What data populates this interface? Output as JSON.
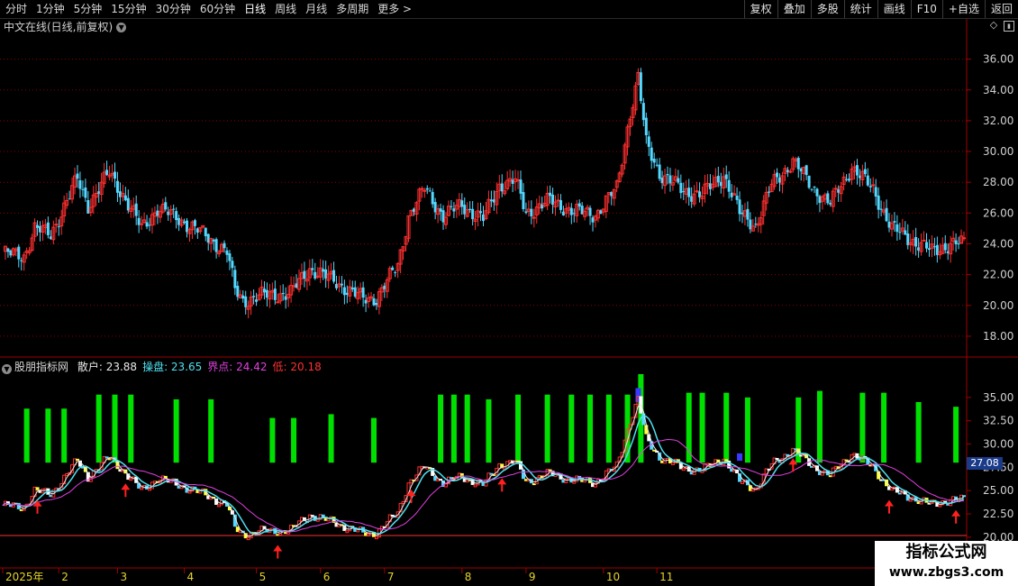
{
  "toolbar": {
    "periods": [
      "分时",
      "1分钟",
      "5分钟",
      "15分钟",
      "30分钟",
      "60分钟",
      "日线",
      "周线",
      "月线",
      "多周期",
      "更多 >"
    ],
    "active_period": "日线",
    "actions": [
      "复权",
      "叠加",
      "多股",
      "统计",
      "画线",
      "F10",
      "+自选",
      "返回"
    ]
  },
  "main_chart": {
    "title": "中文在线(日线,前复权)",
    "icons": [
      "diamond-icon",
      "window-toggle-icon"
    ]
  },
  "indicator_panel": {
    "name": "股朋指标网",
    "values": [
      {
        "label": "散户",
        "value": "23.88",
        "color": "#e8e8e8"
      },
      {
        "label": "操盘",
        "value": "23.65",
        "color": "#4fe0f0"
      },
      {
        "label": "界点",
        "value": "24.42",
        "color": "#e040e0"
      },
      {
        "label": "低",
        "value": "20.18",
        "color": "#ff3030"
      }
    ],
    "current_price_label": "27.08"
  },
  "colors": {
    "up": "#ff3030",
    "down": "#54d8ff",
    "grid": "#8b0000",
    "green_bar": "#00e000",
    "ma_white": "#e8e8e8",
    "ma_cyan": "#4fe0f0",
    "ma_magenta": "#e040e0",
    "arrow": "#ff2020"
  },
  "chart_data": {
    "type": "candlestick",
    "main_axis": {
      "ylim": [
        17,
        37.5
      ],
      "ticks": [
        "36.00",
        "34.00",
        "32.00",
        "30.00",
        "28.00",
        "26.00",
        "24.00",
        "22.00",
        "20.00",
        "18.00"
      ]
    },
    "indicator_axis": {
      "ylim": [
        19.6,
        37.5
      ],
      "ticks": [
        "35.00",
        "32.50",
        "30.00",
        "27.50",
        "25.00",
        "22.50",
        "20.00"
      ]
    },
    "x_labels": [
      "2025年",
      "2",
      "3",
      "4",
      "5",
      "6",
      "7",
      "8",
      "9",
      "10",
      "11"
    ],
    "close_anchors": [
      [
        0,
        23.4
      ],
      [
        8,
        23.2
      ],
      [
        12,
        25.0
      ],
      [
        18,
        24.6
      ],
      [
        28,
        28.2
      ],
      [
        32,
        26.5
      ],
      [
        40,
        28.6
      ],
      [
        45,
        27.2
      ],
      [
        52,
        25.0
      ],
      [
        58,
        26.3
      ],
      [
        64,
        25.8
      ],
      [
        72,
        25.0
      ],
      [
        84,
        23.5
      ],
      [
        87,
        21.0
      ],
      [
        90,
        20.3
      ],
      [
        96,
        20.6
      ],
      [
        108,
        20.8
      ],
      [
        115,
        22.4
      ],
      [
        125,
        21.5
      ],
      [
        135,
        20.4
      ],
      [
        140,
        20.5
      ],
      [
        148,
        22.6
      ],
      [
        152,
        25.8
      ],
      [
        158,
        27.6
      ],
      [
        165,
        25.8
      ],
      [
        172,
        26.5
      ],
      [
        180,
        25.6
      ],
      [
        186,
        27.8
      ],
      [
        192,
        28.1
      ],
      [
        196,
        26.0
      ],
      [
        205,
        26.8
      ],
      [
        214,
        26.1
      ],
      [
        222,
        25.9
      ],
      [
        230,
        27.6
      ],
      [
        235,
        32.5
      ],
      [
        238,
        34.8
      ],
      [
        241,
        30.5
      ],
      [
        246,
        28.6
      ],
      [
        255,
        27.4
      ],
      [
        262,
        27.2
      ],
      [
        270,
        28.5
      ],
      [
        276,
        26.0
      ],
      [
        282,
        25.2
      ],
      [
        288,
        27.8
      ],
      [
        296,
        29.4
      ],
      [
        303,
        27.7
      ],
      [
        310,
        26.6
      ],
      [
        318,
        29.0
      ],
      [
        326,
        27.5
      ],
      [
        333,
        25.0
      ],
      [
        340,
        24.3
      ],
      [
        348,
        23.5
      ],
      [
        355,
        24.0
      ]
    ],
    "green_bar_tops": [
      [
        9,
        33.8
      ],
      [
        17,
        33.8
      ],
      [
        23,
        33.8
      ],
      [
        36,
        35.3
      ],
      [
        42,
        35.3
      ],
      [
        48,
        35.3
      ],
      [
        65,
        34.8
      ],
      [
        78,
        34.8
      ],
      [
        101,
        32.8
      ],
      [
        109,
        32.8
      ],
      [
        123,
        33.2
      ],
      [
        139,
        32.8
      ],
      [
        164,
        35.3
      ],
      [
        169,
        35.3
      ],
      [
        174,
        35.3
      ],
      [
        182,
        34.8
      ],
      [
        193,
        35.3
      ],
      [
        204,
        35.3
      ],
      [
        213,
        35.3
      ],
      [
        220,
        35.3
      ],
      [
        227,
        35.3
      ],
      [
        234,
        35.3
      ],
      [
        239,
        37.5
      ],
      [
        257,
        35.5
      ],
      [
        262,
        35.5
      ],
      [
        271,
        35.5
      ],
      [
        279,
        35.0
      ],
      [
        298,
        35.0
      ],
      [
        306,
        35.7
      ],
      [
        322,
        35.5
      ],
      [
        330,
        35.5
      ],
      [
        343,
        34.5
      ],
      [
        357,
        34.0
      ]
    ],
    "purple_blocks": [
      [
        238,
        36.0,
        34.5
      ],
      [
        276,
        29.0,
        28.2
      ]
    ],
    "arrows": [
      13,
      46,
      103,
      153,
      187,
      296,
      332,
      357
    ]
  }
}
